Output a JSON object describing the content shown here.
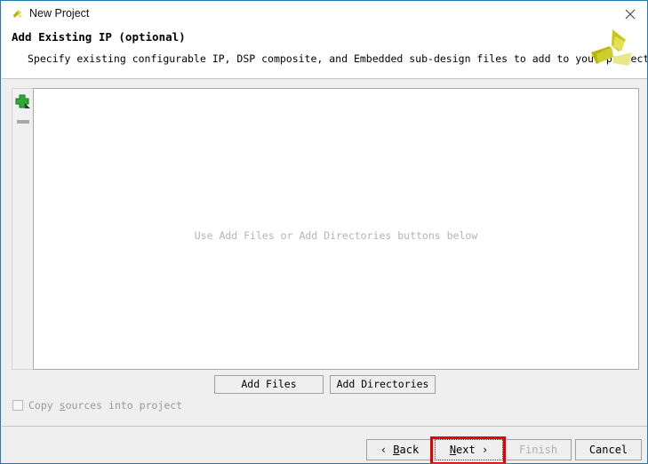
{
  "window": {
    "title": "New Project",
    "title_icon": "altera-logo-icon",
    "close_icon": "close-icon",
    "border_color": "#2a7ab0"
  },
  "header": {
    "title": "Add Existing IP (optional)",
    "description": "Specify existing configurable IP, DSP composite, and Embedded sub-design files to add to your project.",
    "logo_icon": "altera-pinwheel-logo"
  },
  "toolbar": {
    "add_icon": "green-plus-icon",
    "remove_icon": "grey-minus-icon",
    "add_tooltip": "Add",
    "remove_tooltip": "Remove"
  },
  "list": {
    "placeholder": "Use Add Files or Add Directories buttons below",
    "items": []
  },
  "actions": {
    "add_files_label": "Add Files",
    "add_directories_label": "Add Directories"
  },
  "options": {
    "copy_sources_label_before": "Copy ",
    "copy_sources_mnemonic": "s",
    "copy_sources_label_after": "ources into project",
    "copy_sources_checked": false
  },
  "footer": {
    "back_prefix": "‹ ",
    "back_mnemonic": "B",
    "back_suffix": "ack",
    "next_mnemonic": "N",
    "next_suffix": "ext ›",
    "finish_label": "Finish",
    "finish_enabled": false,
    "cancel_label": "Cancel",
    "focused_button": "Next",
    "highlight_color": "#e80000"
  }
}
